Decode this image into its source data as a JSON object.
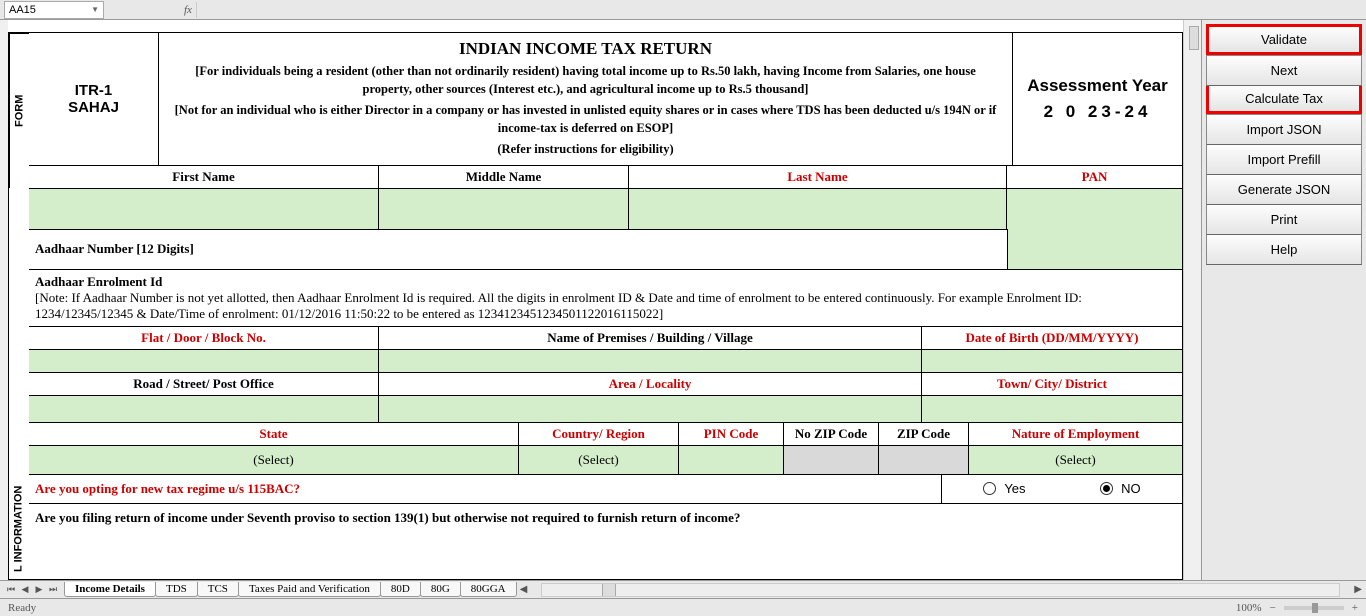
{
  "nameBox": "AA15",
  "form": {
    "vertLabel1": "FORM",
    "vertLabel2": "L INFORMATION",
    "itrLine1": "ITR-1",
    "itrLine2": "SAHAJ",
    "title": "INDIAN INCOME TAX RETURN",
    "subtitle1": "[For individuals being a resident (other than not ordinarily resident) having total income up to Rs.50 lakh, having Income from Salaries, one house property, other sources (Interest etc.), and agricultural income up to Rs.5 thousand]",
    "subtitle2": "[Not for an individual who is either Director in a company or has invested in unlisted equity shares or in cases where TDS has been deducted u/s 194N or if income-tax is deferred on ESOP]",
    "subtitle3": "(Refer instructions for eligibility)",
    "ayLabel": "Assessment Year",
    "ayYear": "2 0 23-24",
    "headers": {
      "firstName": "First Name",
      "middleName": "Middle Name",
      "lastName": "Last Name",
      "pan": "PAN"
    },
    "aadhaarLabel": "Aadhaar Number [12 Digits]",
    "enrolLabel": "Aadhaar Enrolment Id",
    "enrolNote": "[Note: If Aadhaar Number is not yet allotted, then Aadhaar Enrolment Id is required. All the digits in enrolment ID & Date and time of enrolment to be entered continuously. For example Enrolment ID: 1234/12345/12345 & Date/Time of enrolment: 01/12/2016 11:50:22 to be entered as 1234123451234501122016115022]",
    "addr1": {
      "flat": "Flat / Door / Block No.",
      "premises": "Name of Premises / Building / Village",
      "dob": "Date of Birth (DD/MM/YYYY)"
    },
    "addr2": {
      "road": "Road / Street/ Post Office",
      "area": "Area / Locality",
      "town": "Town/ City/ District"
    },
    "sel": {
      "state": "State",
      "country": "Country/ Region",
      "pin": "PIN Code",
      "nozip": "No ZIP Code",
      "zip": "ZIP Code",
      "nature": "Nature of Employment",
      "selectText": "(Select)"
    },
    "q1": "Are you opting for new tax regime u/s 115BAC?",
    "q2": "Are you filing return of income under Seventh proviso to section 139(1) but otherwise not required to furnish return of income?",
    "yes": "Yes",
    "no": "NO"
  },
  "sidebar": {
    "validate": "Validate",
    "next": "Next",
    "calc": "Calculate Tax",
    "importJson": "Import JSON",
    "importPrefill": "Import Prefill",
    "genJson": "Generate JSON",
    "print": "Print",
    "help": "Help"
  },
  "tabs": [
    "Income Details",
    "TDS",
    "TCS",
    "Taxes Paid and Verification",
    "80D",
    "80G",
    "80GGA"
  ],
  "status": "Ready",
  "zoom": "100%"
}
